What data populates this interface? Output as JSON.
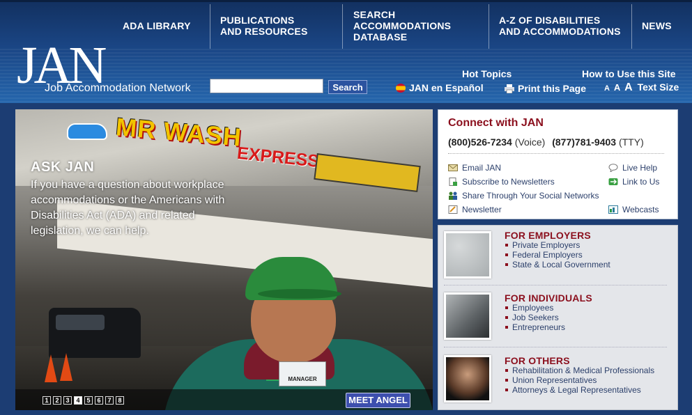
{
  "nav": {
    "items": [
      {
        "label": "ADA LIBRARY"
      },
      {
        "label": "PUBLICATIONS\nAND RESOURCES"
      },
      {
        "label": "SEARCH\nACCOMMODATIONS\nDATABASE"
      },
      {
        "label": "A-Z OF DISABILITIES\nAND ACCOMMODATIONS"
      },
      {
        "label": "NEWS"
      }
    ]
  },
  "logo": {
    "main": "JAN",
    "sub": "Job Accommodation Network"
  },
  "search": {
    "value": "",
    "button": "Search"
  },
  "utility": {
    "hot_topics": "Hot Topics",
    "how_to": "How to Use this Site",
    "espanol": "JAN en Español",
    "print": "Print this Page",
    "text_size_a": "A",
    "text_size_label": "Text Size"
  },
  "hero": {
    "title": "ASK JAN",
    "text": "If you have a question about workplace accommodations or the Americans with Disabilities Act (ADA) and related legislation, we can help.",
    "sign_main": "MR WASH",
    "sign_express": "EXPRESS",
    "badge": "MANAGER",
    "pages": [
      "1",
      "2",
      "3",
      "4",
      "5",
      "6",
      "7",
      "8"
    ],
    "active_page": 4,
    "cta": "MEET ANGEL"
  },
  "connect": {
    "title": "Connect with JAN",
    "voice_number": "(800)526-7234",
    "voice_label": "(Voice)",
    "tty_number": "(877)781-9403",
    "tty_label": "(TTY)",
    "links_left": [
      {
        "label": "Email JAN",
        "icon": "email-icon"
      },
      {
        "label": "Subscribe to Newsletters",
        "icon": "document-plus-icon"
      },
      {
        "label": "Share Through Your Social Networks",
        "icon": "people-icon"
      },
      {
        "label": "Newsletter",
        "icon": "newsletter-icon"
      }
    ],
    "links_right": [
      {
        "label": "Live Help",
        "icon": "chat-icon"
      },
      {
        "label": "Link to Us",
        "icon": "link-icon"
      },
      {
        "label": "Webcasts",
        "icon": "webcast-icon"
      }
    ]
  },
  "audiences": [
    {
      "title": "FOR EMPLOYERS",
      "items": [
        "Private Employers",
        "Federal Employers",
        "State & Local Government"
      ]
    },
    {
      "title": "FOR INDIVIDUALS",
      "items": [
        "Employees",
        "Job Seekers",
        "Entrepreneurs"
      ]
    },
    {
      "title": "FOR OTHERS",
      "items": [
        "Rehabilitation & Medical Professionals",
        "Union Representatives",
        "Attorneys & Legal Representatives"
      ]
    }
  ],
  "colors": {
    "header": "#1a4584",
    "accent_red": "#8b0f1d",
    "link_blue": "#2b3f6a",
    "button_blue": "#2c53a0"
  }
}
